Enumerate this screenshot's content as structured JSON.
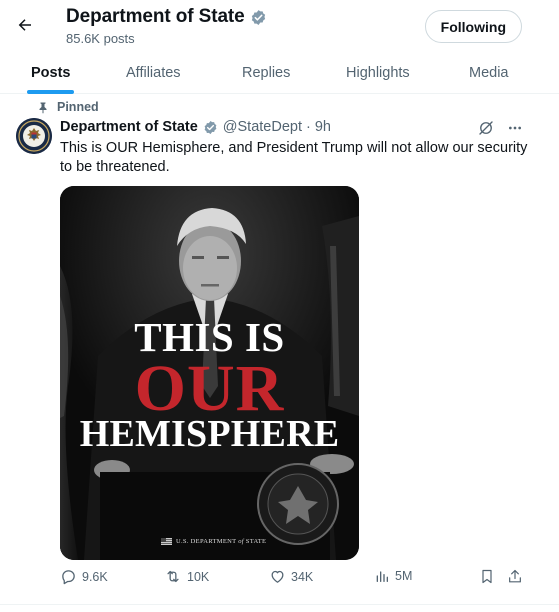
{
  "header": {
    "title": "Department of State",
    "post_count": "85.6K posts",
    "follow_label": "Following"
  },
  "tabs": [
    {
      "label": "Posts",
      "active": true
    },
    {
      "label": "Affiliates",
      "active": false
    },
    {
      "label": "Replies",
      "active": false
    },
    {
      "label": "Highlights",
      "active": false
    },
    {
      "label": "Media",
      "active": false
    }
  ],
  "tweet": {
    "pinned_label": "Pinned",
    "author_name": "Department of State",
    "handle_time": "@StateDept · 9h",
    "text": "This is OUR Hemisphere, and President Trump will not allow our security to be threatened.",
    "media": {
      "line1": "THIS IS",
      "line2": "OUR",
      "line3": "HEMISPHERE",
      "caption_pre": "U.S. DEPARTMENT ",
      "caption_of": "of",
      "caption_post": " STATE"
    },
    "stats": {
      "replies": "9.6K",
      "reposts": "10K",
      "likes": "34K",
      "views": "5M"
    }
  },
  "colors": {
    "accent": "#1d9bf0",
    "verified": "#829aab",
    "text_primary": "#0f1419",
    "text_secondary": "#536471",
    "headline_red": "#c4262c"
  },
  "icons": [
    "back-arrow-icon",
    "verified-badge-icon",
    "pin-icon",
    "grok-icon",
    "more-icon",
    "reply-icon",
    "repost-icon",
    "like-icon",
    "views-icon",
    "bookmark-icon",
    "share-icon"
  ]
}
